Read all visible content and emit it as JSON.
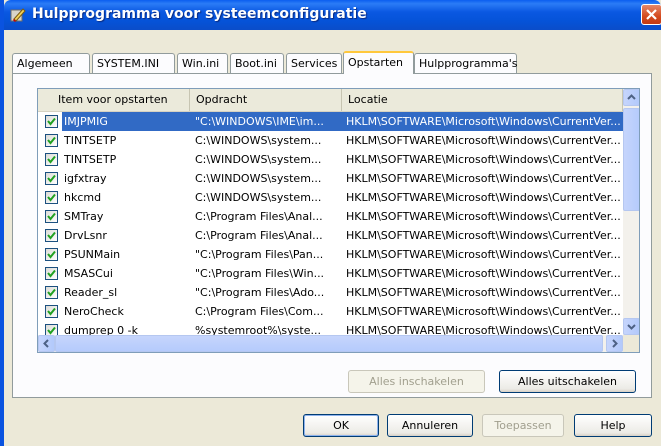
{
  "window": {
    "title": "Hulpprogramma voor systeemconfiguratie"
  },
  "tabs": [
    {
      "label": "Algemeen"
    },
    {
      "label": "SYSTEM.INI"
    },
    {
      "label": "Win.ini"
    },
    {
      "label": "Boot.ini"
    },
    {
      "label": "Services"
    },
    {
      "label": "Opstarten",
      "active": true
    },
    {
      "label": "Hulpprogramma's"
    }
  ],
  "list": {
    "columns": [
      "Item voor opstarten",
      "Opdracht",
      "Locatie"
    ],
    "rows": [
      {
        "checked": true,
        "item": "IMJPMIG",
        "command": "\"C:\\WINDOWS\\IME\\im...",
        "location": "HKLM\\SOFTWARE\\Microsoft\\Windows\\CurrentVer...",
        "selected": true
      },
      {
        "checked": true,
        "item": "TINTSETP",
        "command": "C:\\WINDOWS\\system...",
        "location": "HKLM\\SOFTWARE\\Microsoft\\Windows\\CurrentVer..."
      },
      {
        "checked": true,
        "item": "TINTSETP",
        "command": "C:\\WINDOWS\\system...",
        "location": "HKLM\\SOFTWARE\\Microsoft\\Windows\\CurrentVer..."
      },
      {
        "checked": true,
        "item": "igfxtray",
        "command": "C:\\WINDOWS\\system...",
        "location": "HKLM\\SOFTWARE\\Microsoft\\Windows\\CurrentVer..."
      },
      {
        "checked": true,
        "item": "hkcmd",
        "command": "C:\\WINDOWS\\system...",
        "location": "HKLM\\SOFTWARE\\Microsoft\\Windows\\CurrentVer..."
      },
      {
        "checked": true,
        "item": "SMTray",
        "command": "C:\\Program Files\\Anal...",
        "location": "HKLM\\SOFTWARE\\Microsoft\\Windows\\CurrentVer..."
      },
      {
        "checked": true,
        "item": "DrvLsnr",
        "command": "C:\\Program Files\\Anal...",
        "location": "HKLM\\SOFTWARE\\Microsoft\\Windows\\CurrentVer..."
      },
      {
        "checked": true,
        "item": "PSUNMain",
        "command": "\"C:\\Program Files\\Pan...",
        "location": "HKLM\\SOFTWARE\\Microsoft\\Windows\\CurrentVer..."
      },
      {
        "checked": true,
        "item": "MSASCui",
        "command": "\"C:\\Program Files\\Win...",
        "location": "HKLM\\SOFTWARE\\Microsoft\\Windows\\CurrentVer..."
      },
      {
        "checked": true,
        "item": "Reader_sl",
        "command": "\"C:\\Program Files\\Ado...",
        "location": "HKLM\\SOFTWARE\\Microsoft\\Windows\\CurrentVer..."
      },
      {
        "checked": true,
        "item": "NeroCheck",
        "command": "C:\\Program Files\\Com...",
        "location": "HKLM\\SOFTWARE\\Microsoft\\Windows\\CurrentVer..."
      },
      {
        "checked": true,
        "item": "dumprep 0 -k",
        "command": "%systemroot%\\syste...",
        "location": "HKLM\\SOFTWARE\\Microsoft\\Windows\\CurrentVer..."
      }
    ]
  },
  "buttons": {
    "enable_all": {
      "label": "Alles inschakelen",
      "enabled": false
    },
    "disable_all": {
      "label": "Alles uitschakelen",
      "enabled": true
    },
    "ok": {
      "label": "OK"
    },
    "cancel": {
      "label": "Annuleren"
    },
    "apply": {
      "label": "Toepassen",
      "enabled": false
    },
    "help": {
      "label": "Help"
    }
  },
  "colors": {
    "titlebar": "#0a58e2",
    "selection": "#316ac5",
    "active_tab_accent": "#ffc83c"
  }
}
